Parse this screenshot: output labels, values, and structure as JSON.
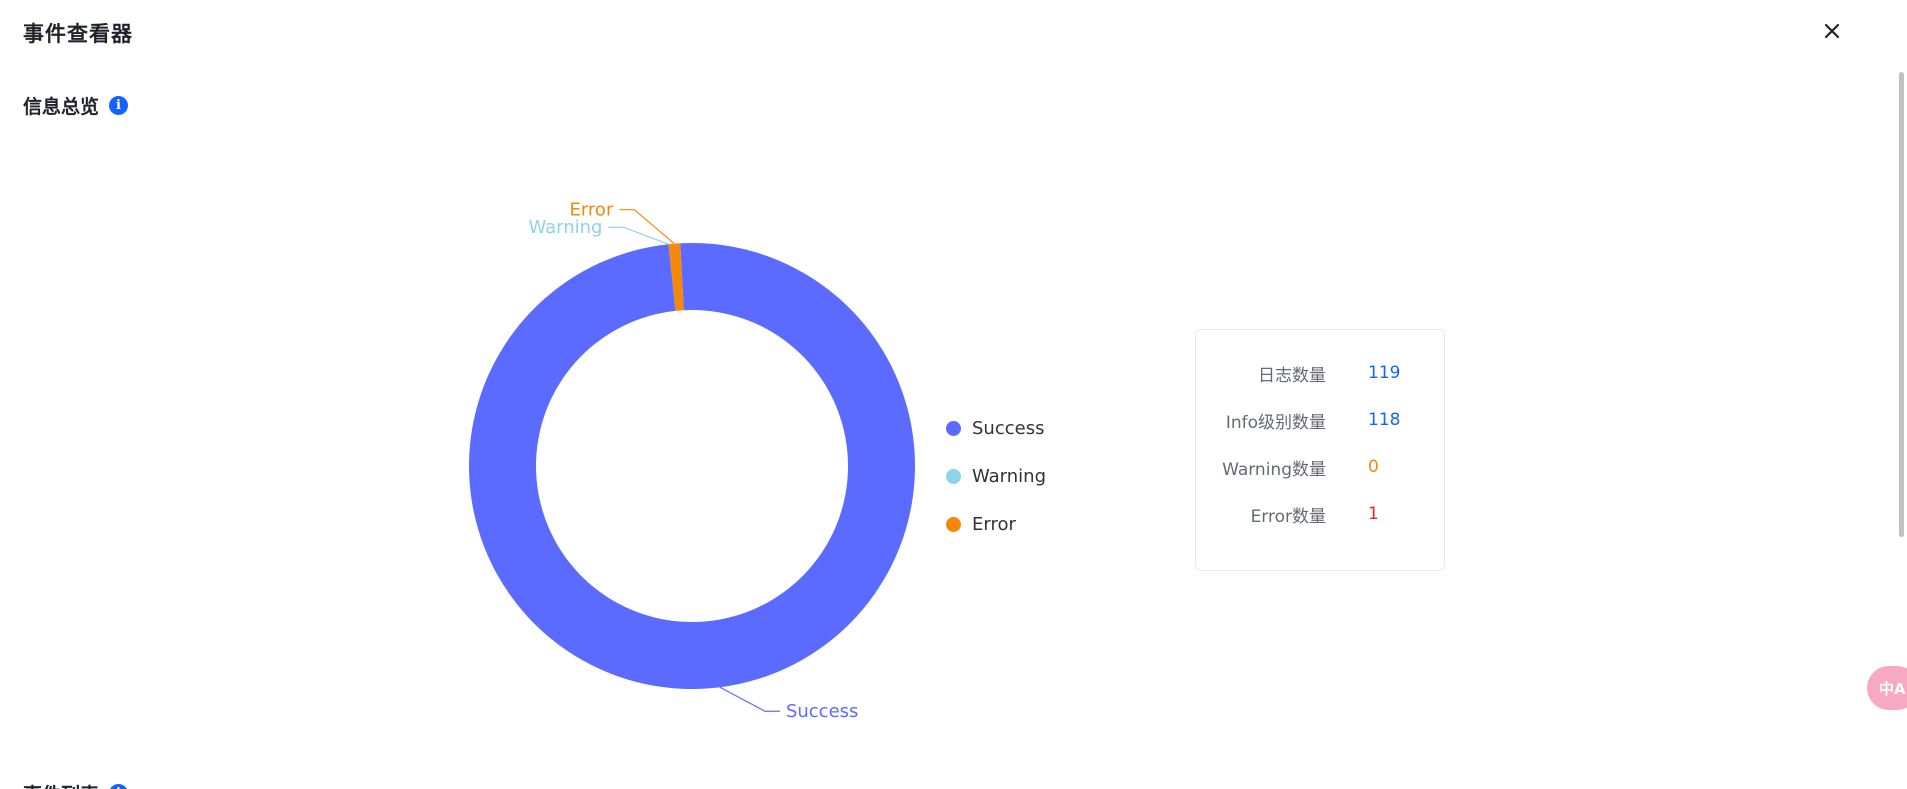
{
  "window": {
    "title": "事件查看器",
    "close_icon": "close-icon"
  },
  "overview": {
    "title": "信息总览",
    "info_icon": "info-icon"
  },
  "next_section": {
    "title": "事件列表"
  },
  "chart_data": {
    "type": "pie",
    "variant": "donut",
    "categories": [
      "Success",
      "Warning",
      "Error"
    ],
    "values": [
      118,
      0,
      1
    ],
    "colors": [
      "#5b6bff",
      "#8dd3e9",
      "#f5880b"
    ],
    "legend_position": "right"
  },
  "stats": {
    "rows": [
      {
        "label": "日志数量",
        "value": "119",
        "color": "#1463ff"
      },
      {
        "label": "Info级别数量",
        "value": "118",
        "color": "#1463ff"
      },
      {
        "label": "Warning数量",
        "value": "0",
        "color": "#f5880b"
      },
      {
        "label": "Error数量",
        "value": "1",
        "color": "#f5222d"
      }
    ]
  },
  "translate_widget": {
    "label": "中A",
    "icon": "translate-icon"
  }
}
